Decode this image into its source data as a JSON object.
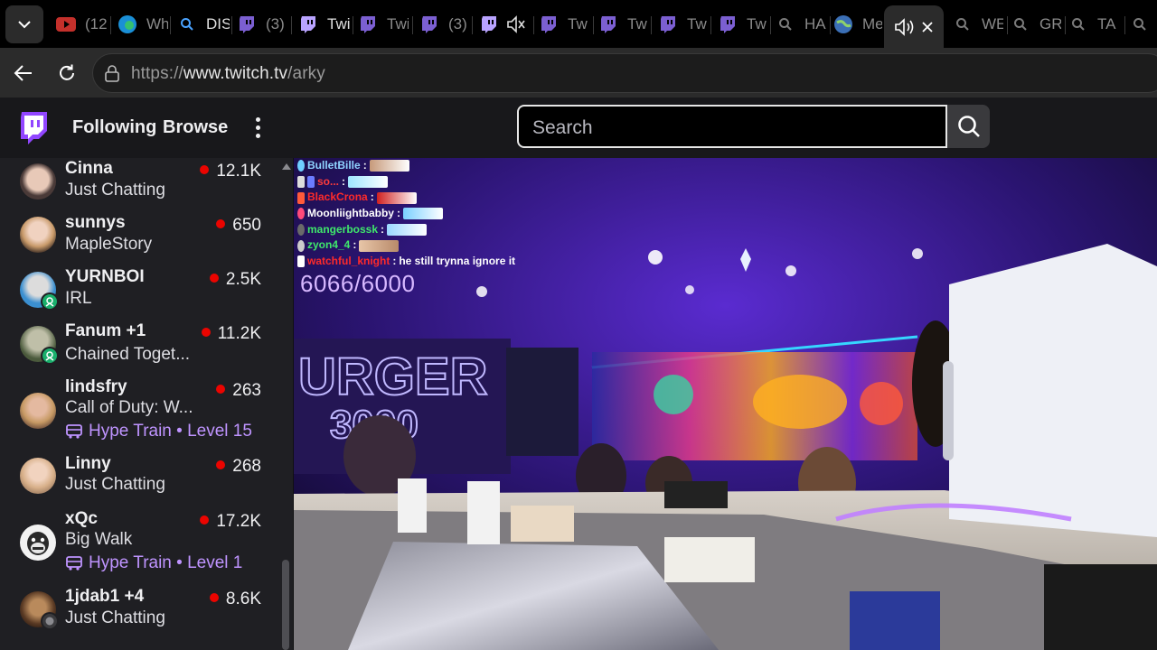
{
  "browser": {
    "tabs": [
      {
        "icon": "youtube-icon",
        "title": "(12"
      },
      {
        "icon": "edge-icon",
        "title": "Wh"
      },
      {
        "icon": "search-icon",
        "title": "DIS"
      },
      {
        "icon": "twitch-icon",
        "title": "(3)"
      },
      {
        "icon": "twitch-icon",
        "title": "Twi"
      },
      {
        "icon": "twitch-icon",
        "title": "Twi"
      },
      {
        "icon": "twitch-icon",
        "title": "(3)"
      },
      {
        "icon": "twitch-icon",
        "title": ""
      },
      {
        "icon": "twitch-icon",
        "title": "Tw"
      },
      {
        "icon": "twitch-icon",
        "title": "Tw"
      },
      {
        "icon": "twitch-icon",
        "title": "Tw"
      },
      {
        "icon": "twitch-icon",
        "title": "Tw"
      },
      {
        "icon": "search-icon",
        "title": "HA"
      },
      {
        "icon": "globe-icon",
        "title": "Me"
      },
      {
        "icon": "search-icon",
        "title": "WE"
      },
      {
        "icon": "search-icon",
        "title": "GR"
      },
      {
        "icon": "search-icon",
        "title": "TA"
      }
    ],
    "address": {
      "prefix": "https://",
      "host": "www.twitch.tv",
      "path": "/arky"
    }
  },
  "twitch": {
    "nav": {
      "following": "Following",
      "browse": "Browse"
    },
    "search": {
      "placeholder": "Search"
    },
    "sidebar": {
      "channels": [
        {
          "name": "Cinna",
          "category": "Just Chatting",
          "viewers": "12.1K"
        },
        {
          "name": "sunnys",
          "category": "MapleStory",
          "viewers": "650"
        },
        {
          "name": "YURNBOI",
          "category": "IRL",
          "viewers": "2.5K"
        },
        {
          "name": "Fanum +1",
          "category": "Chained Toget...",
          "viewers": "11.2K"
        },
        {
          "name": "lindsfry",
          "category": "Call of Duty: W...",
          "viewers": "263",
          "hype": "Hype Train • Level 15"
        },
        {
          "name": "Linny",
          "category": "Just Chatting",
          "viewers": "268"
        },
        {
          "name": "xQc",
          "category": "Big Walk",
          "viewers": "17.2K",
          "hype": "Hype Train • Level 1"
        },
        {
          "name": "1jdab1 +4",
          "category": "Just Chatting",
          "viewers": "8.6K"
        }
      ]
    },
    "overlay": {
      "chat": [
        {
          "user": "BulletBille",
          "color": "#8fd3ff",
          "message": ""
        },
        {
          "user": "so...",
          "color": "#ff3b3b",
          "message": ""
        },
        {
          "user": "BlackCrona",
          "color": "#ff2a2a",
          "message": ""
        },
        {
          "user": "Moonliightbabby",
          "color": "#ffffff",
          "message": ""
        },
        {
          "user": "mangerbossk",
          "color": "#3fe86b",
          "message": ""
        },
        {
          "user": "zyon4_4",
          "color": "#3fe86b",
          "message": ""
        },
        {
          "user": "watchful_knight",
          "color": "#ff2a2a",
          "message": "he still trynna ignore it"
        }
      ],
      "counter": "6066/6000"
    }
  },
  "colors": {
    "twitch_purple": "#9146ff",
    "live_red": "#eb0400",
    "hype_purple": "#bf94ff"
  }
}
